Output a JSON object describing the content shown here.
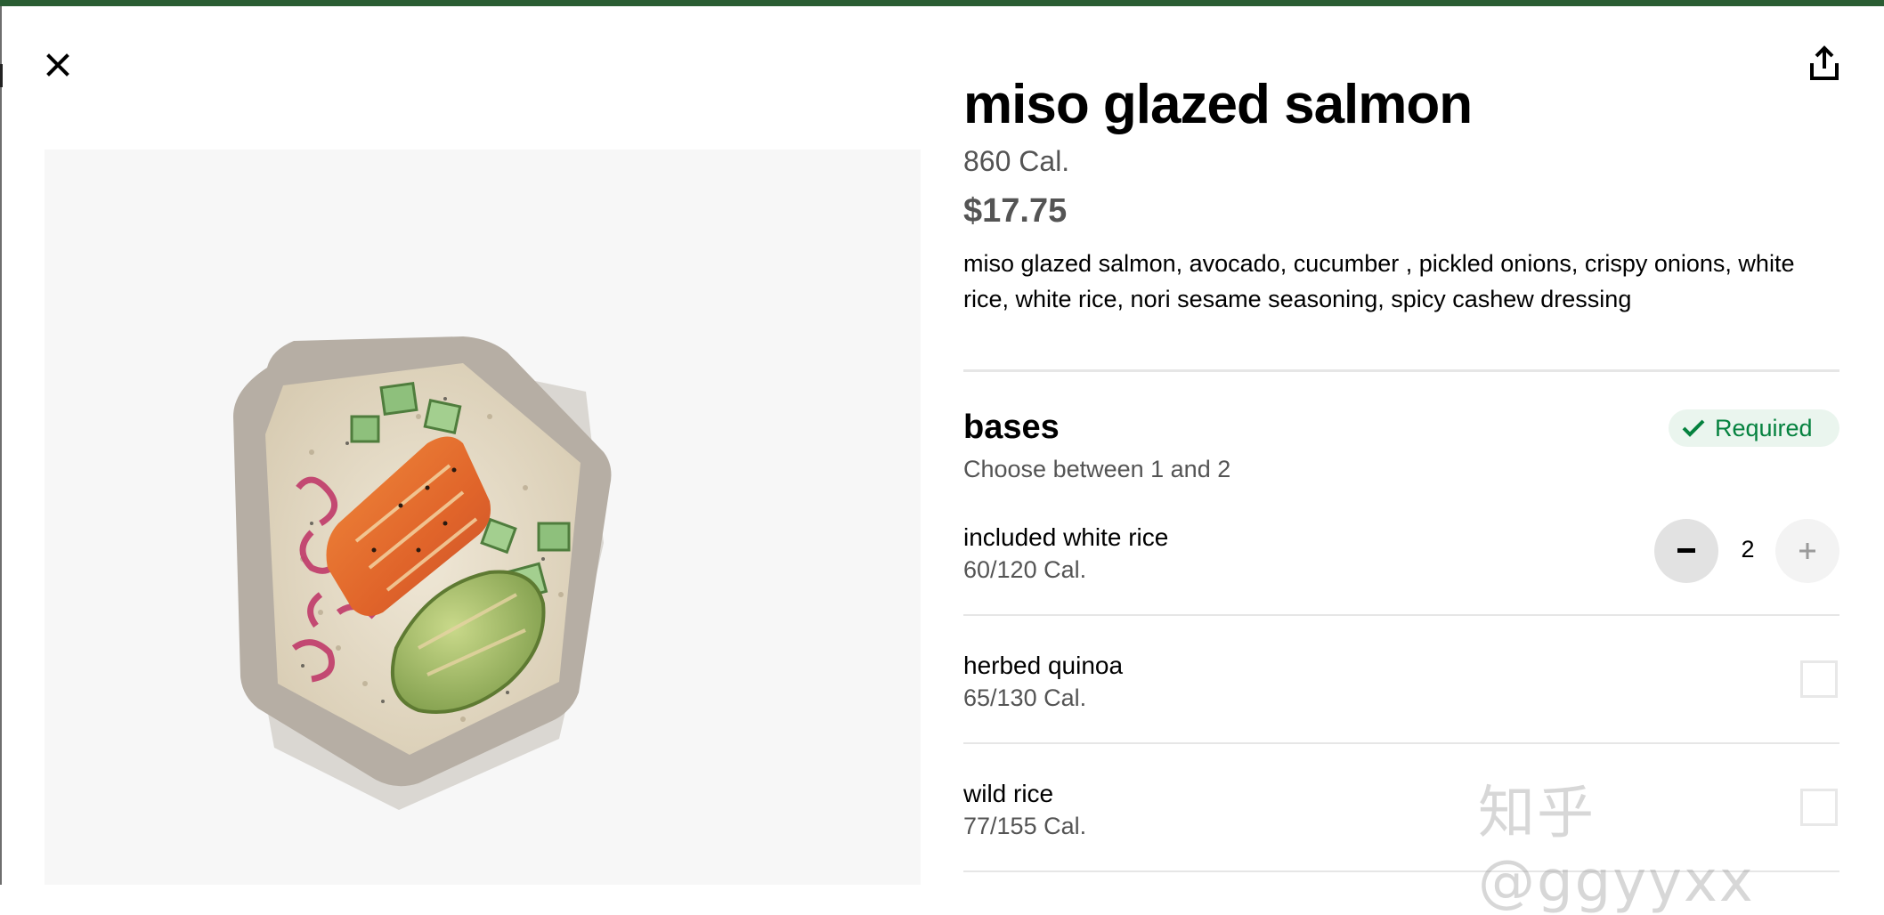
{
  "item": {
    "title": "miso glazed salmon",
    "calories": "860 Cal.",
    "price": "$17.75",
    "description": "miso glazed salmon, avocado, cucumber , pickled onions, crispy onions, white rice, white rice, nori sesame seasoning, spicy cashew dressing"
  },
  "section": {
    "title": "bases",
    "subtitle": "Choose between 1 and 2",
    "badge": "Required"
  },
  "options": [
    {
      "name": "included white rice",
      "calories": "60/120 Cal.",
      "quantity": "2",
      "control": "stepper"
    },
    {
      "name": "herbed quinoa",
      "calories": "65/130 Cal.",
      "control": "checkbox",
      "checked": false
    },
    {
      "name": "wild rice",
      "calories": "77/155 Cal.",
      "control": "checkbox",
      "checked": false
    }
  ],
  "watermark": "知乎 @ggyyxx",
  "icons": {
    "close": "close-icon",
    "share": "share-icon",
    "check": "check-icon",
    "minus": "minus-icon",
    "plus": "plus-icon"
  },
  "colors": {
    "top_strip": "#2a5d33",
    "required_text": "#05823f",
    "required_bg": "#eaf5ee",
    "secondary_text": "#545454"
  }
}
